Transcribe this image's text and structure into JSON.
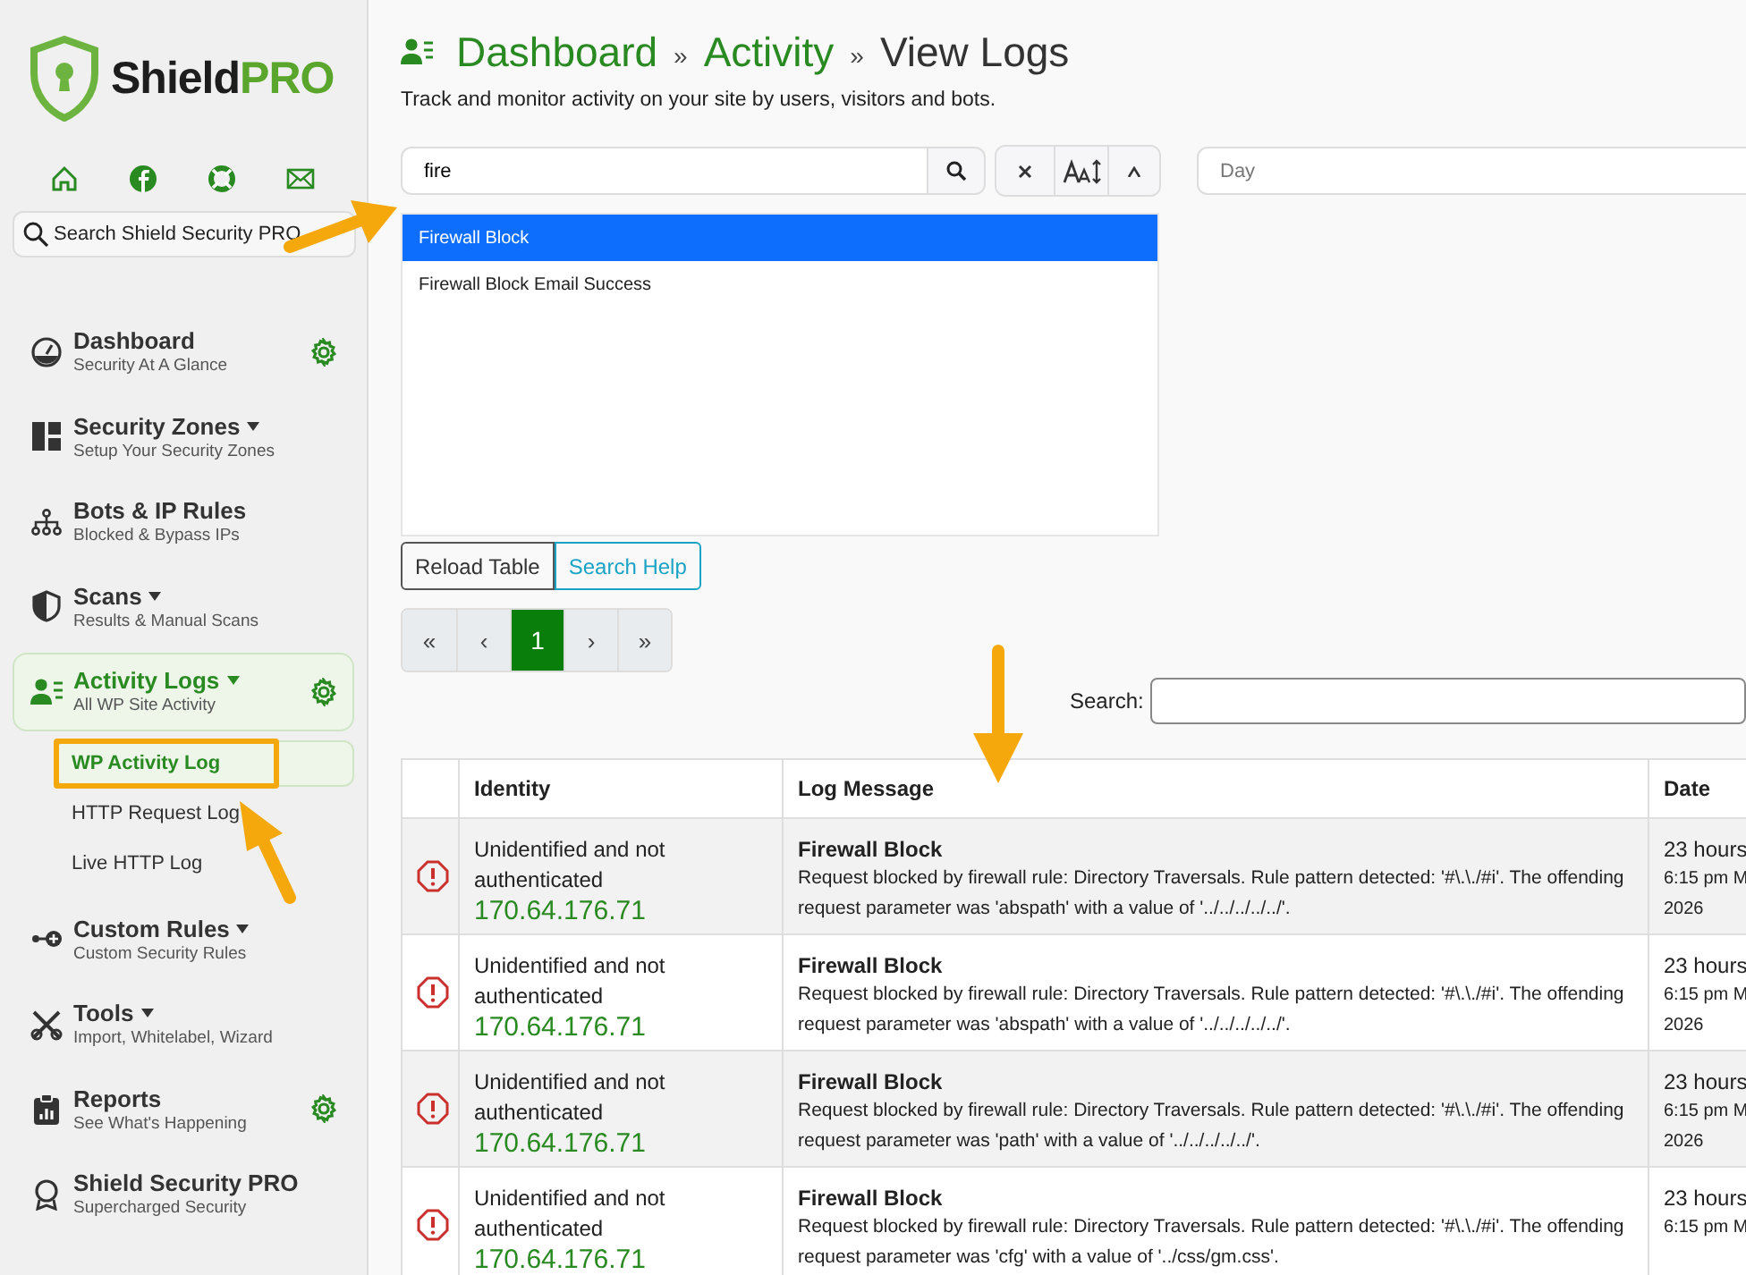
{
  "sidebar": {
    "brand_name": "Shield",
    "brand_suffix": "PRO",
    "search": {
      "placeholder": "Search Shield Security PRO"
    },
    "nav": [
      {
        "title": "Dashboard",
        "subtitle": "Security At A Glance",
        "has_dropdown": false,
        "has_settings": true,
        "selected": false
      },
      {
        "title": "Security Zones",
        "subtitle": "Setup Your Security Zones",
        "has_dropdown": true,
        "has_settings": false,
        "selected": false
      },
      {
        "title": "Bots & IP Rules",
        "subtitle": "Blocked & Bypass IPs",
        "has_dropdown": false,
        "has_settings": false,
        "selected": false
      },
      {
        "title": "Scans",
        "subtitle": "Results & Manual Scans",
        "has_dropdown": true,
        "has_settings": false,
        "selected": false
      },
      {
        "title": "Activity Logs",
        "subtitle": "All WP Site Activity",
        "has_dropdown": true,
        "has_settings": true,
        "selected": true,
        "children": [
          {
            "label": "WP Activity Log",
            "selected": true
          },
          {
            "label": "HTTP Request Log",
            "selected": false
          },
          {
            "label": "Live HTTP Log",
            "selected": false
          }
        ]
      },
      {
        "title": "Custom Rules",
        "subtitle": "Custom Security Rules",
        "has_dropdown": true,
        "has_settings": false,
        "selected": false
      },
      {
        "title": "Tools",
        "subtitle": "Import, Whitelabel, Wizard",
        "has_dropdown": true,
        "has_settings": false,
        "selected": false
      },
      {
        "title": "Reports",
        "subtitle": "See What's Happening",
        "has_dropdown": false,
        "has_settings": true,
        "selected": false
      },
      {
        "title": "Shield Security PRO",
        "subtitle": "Supercharged Security",
        "has_dropdown": false,
        "has_settings": false,
        "selected": false
      }
    ]
  },
  "page": {
    "breadcrumb": [
      "Dashboard",
      "Activity",
      "View Logs"
    ],
    "separator": "»",
    "description": "Track and monitor activity on your site by users, visitors and bots.",
    "filter": {
      "value": "fire",
      "date_placeholder": "Day",
      "suggestions": [
        {
          "label": "Firewall Block",
          "selected": true
        },
        {
          "label": "Firewall Block Email Success",
          "selected": false
        }
      ]
    },
    "actions": [
      "Reload Table",
      "Search Help"
    ],
    "pagination": [
      {
        "label": "«",
        "selected": false
      },
      {
        "label": "‹",
        "selected": false
      },
      {
        "label": "1",
        "selected": true
      },
      {
        "label": "›",
        "selected": false
      },
      {
        "label": "»",
        "selected": false
      }
    ],
    "search_label": "Search:"
  },
  "table": {
    "columns": [
      "Identity",
      "Log Message",
      "Date"
    ],
    "rows": [
      {
        "identity": "Unidentified and not authenticated",
        "ip": "170.64.176.71",
        "title": "Firewall Block",
        "message": "Request blocked by firewall rule: Directory Traversals. Rule pattern detected: '#\\.\\./#i'. The offending request parameter was 'abspath' with a value of '../../../../../'.",
        "date": "23 hours",
        "date_detail": "6:15 pm M",
        "date_year": "2026"
      },
      {
        "identity": "Unidentified and not authenticated",
        "ip": "170.64.176.71",
        "title": "Firewall Block",
        "message": "Request blocked by firewall rule: Directory Traversals. Rule pattern detected: '#\\.\\./#i'. The offending request parameter was 'abspath' with a value of '../../../../../'.",
        "date": "23 hours",
        "date_detail": "6:15 pm M",
        "date_year": "2026"
      },
      {
        "identity": "Unidentified and not authenticated",
        "ip": "170.64.176.71",
        "title": "Firewall Block",
        "message": "Request blocked by firewall rule: Directory Traversals. Rule pattern detected: '#\\.\\./#i'. The offending request parameter was 'path' with a value of '../../../../../'.",
        "date": "23 hours",
        "date_detail": "6:15 pm M",
        "date_year": "2026"
      },
      {
        "identity": "Unidentified and not authenticated",
        "ip": "170.64.176.71",
        "title": "Firewall Block",
        "message": "Request blocked by firewall rule: Directory Traversals. Rule pattern detected: '#\\.\\./#i'. The offending request parameter was 'cfg' with a value of '../css/gm.css'.",
        "date": "23 hours",
        "date_detail": "6:15 pm M"
      }
    ]
  }
}
